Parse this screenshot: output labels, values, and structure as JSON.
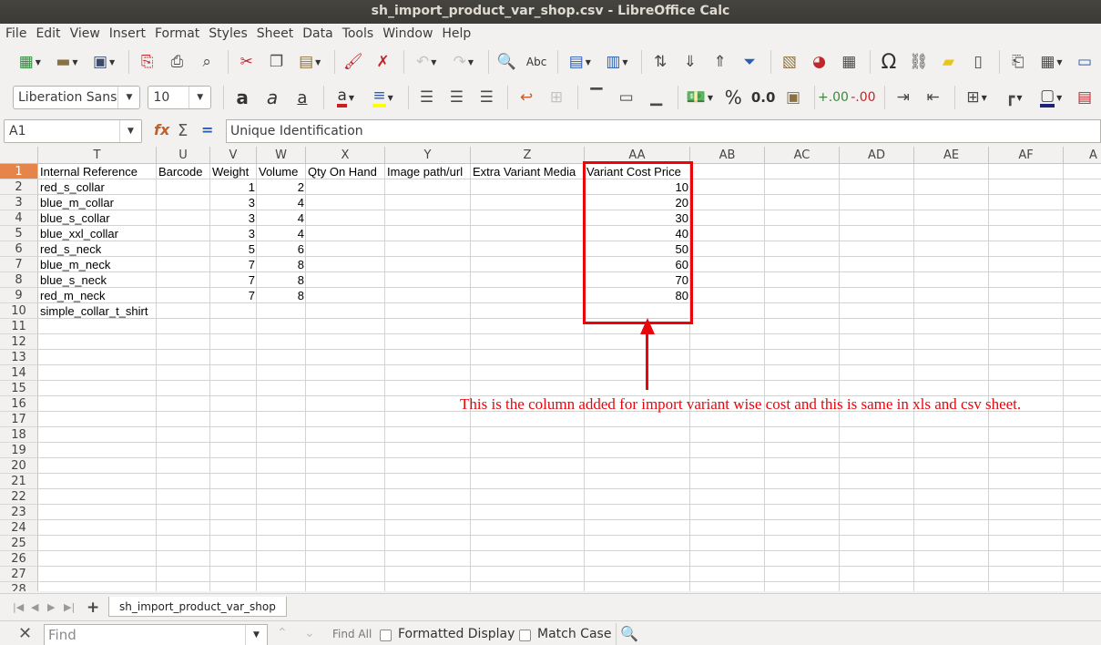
{
  "window": {
    "title": "sh_import_product_var_shop.csv - LibreOffice Calc"
  },
  "menubar": [
    "File",
    "Edit",
    "View",
    "Insert",
    "Format",
    "Styles",
    "Sheet",
    "Data",
    "Tools",
    "Window",
    "Help"
  ],
  "toolbar": {
    "font_name": "Liberation Sans",
    "font_size": "10",
    "percent_label": "%",
    "decimal_label": "0.0",
    "special_char": "Ω"
  },
  "formula_bar": {
    "name_box": "A1",
    "content": "Unique Identification"
  },
  "columns": [
    "T",
    "U",
    "V",
    "W",
    "X",
    "Y",
    "Z",
    "AA",
    "AB",
    "AC",
    "AD",
    "AE",
    "AF",
    "A"
  ],
  "rows": [
    "1",
    "2",
    "3",
    "4",
    "5",
    "6",
    "7",
    "8",
    "9",
    "10",
    "11",
    "12",
    "13",
    "14",
    "15",
    "16",
    "17",
    "18",
    "19",
    "20",
    "21",
    "22",
    "23",
    "24",
    "25",
    "26",
    "27",
    "28"
  ],
  "headers": {
    "T": "Internal Reference",
    "U": "Barcode",
    "V": "Weight",
    "W": "Volume",
    "X": "Qty On Hand",
    "Y": "Image path/url",
    "Z": "Extra Variant Media",
    "AA": "Variant Cost Price"
  },
  "data_rows": [
    {
      "T": "red_s_collar",
      "V": "1",
      "W": "2",
      "AA": "10"
    },
    {
      "T": "blue_m_collar",
      "V": "3",
      "W": "4",
      "AA": "20"
    },
    {
      "T": "blue_s_collar",
      "V": "3",
      "W": "4",
      "AA": "30"
    },
    {
      "T": "blue_xxl_collar",
      "V": "3",
      "W": "4",
      "AA": "40"
    },
    {
      "T": "red_s_neck",
      "V": "5",
      "W": "6",
      "AA": "50"
    },
    {
      "T": "blue_m_neck",
      "V": "7",
      "W": "8",
      "AA": "60"
    },
    {
      "T": "blue_s_neck",
      "V": "7",
      "W": "8",
      "AA": "70"
    },
    {
      "T": "red_m_neck",
      "V": "7",
      "W": "8",
      "AA": "80"
    },
    {
      "T": "simple_collar_t_shirt"
    }
  ],
  "annotation": {
    "text": "This is the column added for import variant wise cost and this is same in xls and csv sheet.",
    "color": "#e8060b"
  },
  "sheet_tabs": [
    "sh_import_product_var_shop"
  ],
  "findbar": {
    "placeholder": "Find",
    "find_all": "Find All",
    "formatted_display": "Formatted Display",
    "match_case": "Match Case"
  },
  "colors": {
    "accent": "#e6854a",
    "annotation_red": "#e8060b"
  }
}
